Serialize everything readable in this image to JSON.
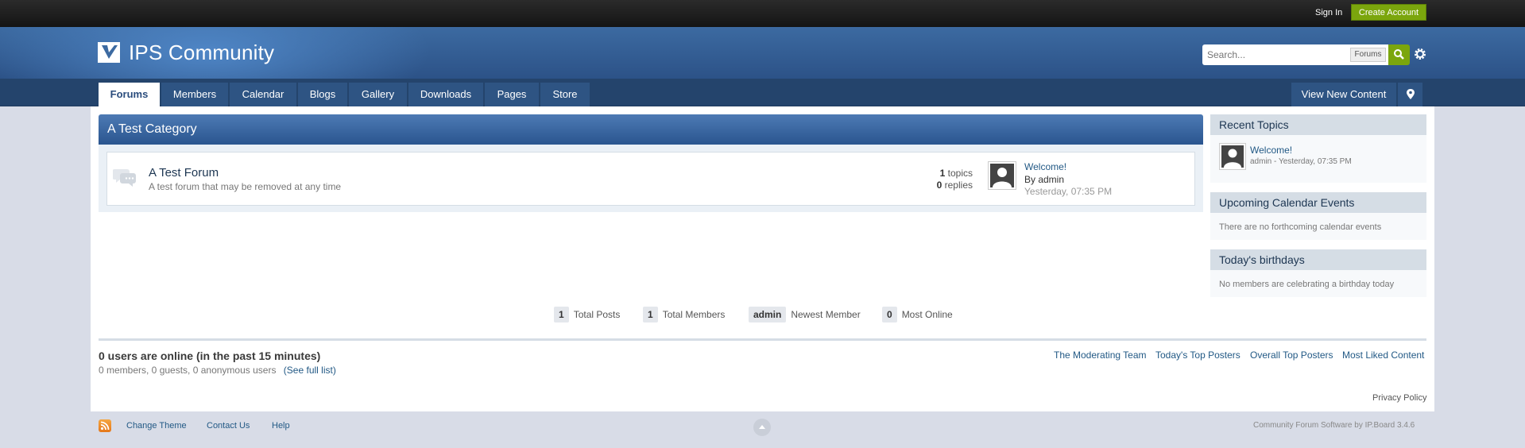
{
  "userbar": {
    "sign_in": "Sign In",
    "create_account": "Create Account"
  },
  "branding": {
    "title": "IPS Community"
  },
  "search": {
    "placeholder": "Search...",
    "scope": "Forums"
  },
  "nav": {
    "tabs": [
      "Forums",
      "Members",
      "Calendar",
      "Blogs",
      "Gallery",
      "Downloads",
      "Pages",
      "Store"
    ],
    "active": "Forums",
    "view_new_content": "View New Content"
  },
  "category": {
    "title": "A Test Category",
    "forum": {
      "title": "A Test Forum",
      "description": "A test forum that may be removed at any time",
      "topics_count": "1",
      "topics_label": "topics",
      "replies_count": "0",
      "replies_label": "replies",
      "last_post": {
        "title": "Welcome!",
        "by": "By admin",
        "date": "Yesterday, 07:35 PM"
      }
    }
  },
  "sidebar": {
    "recent_topics": {
      "title": "Recent Topics",
      "topic": "Welcome!",
      "meta": "admin - Yesterday, 07:35 PM"
    },
    "calendar": {
      "title": "Upcoming Calendar Events",
      "empty": "There are no forthcoming calendar events"
    },
    "birthdays": {
      "title": "Today's birthdays",
      "empty": "No members are celebrating a birthday today"
    }
  },
  "stats": {
    "total_posts": {
      "value": "1",
      "label": "Total Posts"
    },
    "total_members": {
      "value": "1",
      "label": "Total Members"
    },
    "newest_member": {
      "value": "admin",
      "label": "Newest Member"
    },
    "most_online": {
      "value": "0",
      "label": "Most Online"
    }
  },
  "online": {
    "title": "0 users are online (in the past 15 minutes)",
    "summary": "0 members, 0 guests, 0 anonymous users",
    "full_list": "(See full list)"
  },
  "quick_links": [
    "The Moderating Team",
    "Today's Top Posters",
    "Overall Top Posters",
    "Most Liked Content"
  ],
  "privacy": "Privacy Policy",
  "footer": {
    "change_theme": "Change Theme",
    "contact_us": "Contact Us",
    "help": "Help",
    "copyright": "Community Forum Software by IP.Board 3.4.6"
  },
  "colors": {
    "brand_blue": "#2c5287",
    "accent_green": "#7ba60d",
    "nav_bg": "#24446c",
    "link": "#225985"
  },
  "icons": [
    "logo-icon",
    "search-icon",
    "gear-icon",
    "map-pin-icon",
    "forum-bubble-icon",
    "avatar",
    "rss-icon",
    "back-to-top-icon"
  ]
}
